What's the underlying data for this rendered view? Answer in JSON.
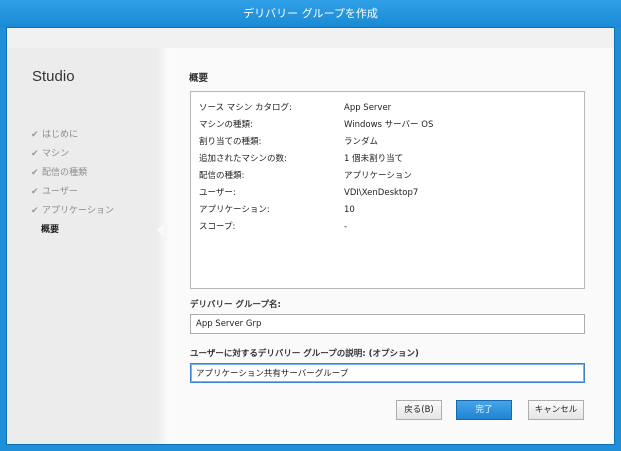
{
  "window": {
    "title": "デリバリー グループを作成"
  },
  "sidebar": {
    "brand": "Studio",
    "steps": [
      {
        "label": "はじめに",
        "done": true
      },
      {
        "label": "マシン",
        "done": true
      },
      {
        "label": "配信の種類",
        "done": true
      },
      {
        "label": "ユーザー",
        "done": true
      },
      {
        "label": "アプリケーション",
        "done": true
      },
      {
        "label": "概要",
        "done": false,
        "current": true
      }
    ]
  },
  "main": {
    "section_title": "概要",
    "summary": [
      {
        "key": "ソース マシン カタログ:",
        "value": "App Server"
      },
      {
        "key": "マシンの種類:",
        "value": "Windows サーバー OS"
      },
      {
        "key": "割り当ての種類:",
        "value": "ランダム"
      },
      {
        "key": "追加されたマシンの数:",
        "value": "1 個未割り当て"
      },
      {
        "key": "配信の種類:",
        "value": "アプリケーション"
      },
      {
        "key": "ユーザー:",
        "value": "VDI\\XenDesktop7"
      },
      {
        "key": "アプリケーション:",
        "value": "10"
      },
      {
        "key": "スコープ:",
        "value": "-"
      }
    ],
    "group_name": {
      "label": "デリバリー グループ名:",
      "value": "App Server Grp"
    },
    "description": {
      "label": "ユーザーに対するデリバリー グループの説明: (オプション)",
      "value": "アプリケーション共有サーバーグループ"
    }
  },
  "buttons": {
    "back": "戻る(B)",
    "finish": "完了",
    "cancel": "キャンセル"
  },
  "colors": {
    "titlebar": "#1b8ad6",
    "primary_button": "#1f83d3"
  }
}
